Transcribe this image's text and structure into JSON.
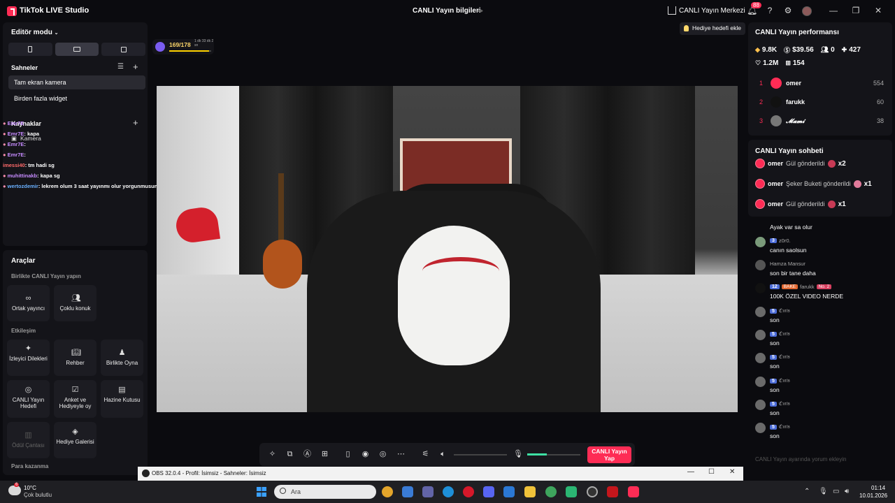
{
  "titlebar": {
    "app_title": "TikTok LIVE Studio",
    "center_title": "CANLI Yayın bilgileri",
    "live_center": "CANLI Yayın Merkezi",
    "notif_count": "88"
  },
  "left": {
    "editor_mode": "Editör modu",
    "scenes_title": "Sahneler",
    "scenes": [
      "Tam ekran kamera",
      "Birden fazla widget"
    ],
    "sources_title": "Kaynaklar",
    "source_camera": "Kamera",
    "tools_title": "Araçlar",
    "section_live_together": "Birlikte CANLI Yayın yapın",
    "section_engagement": "Etkileşim",
    "section_monetize": "Para kazanma",
    "tools_row1": [
      "Ortak yayıncı",
      "Çoklu konuk"
    ],
    "tools_row2": [
      "İzleyici Dilekleri",
      "Rehber",
      "Birlikte Oyna"
    ],
    "tools_row3": [
      "CANLI Yayın Hedefi",
      "Anket ve Hediyeyle oy",
      "Hazine Kutusu"
    ],
    "tools_row4": [
      "Ödül Çantası",
      "Hediye Galerisi"
    ]
  },
  "chat_overlay": [
    {
      "user": "Emr7E",
      "msg": ""
    },
    {
      "user": "Emr7E",
      "msg": ": kapa"
    },
    {
      "user": "Emr7E",
      "msg": ":"
    },
    {
      "user": "Emr7E",
      "msg": ":"
    },
    {
      "user": "imessi40",
      "msg": ": tm hadi sg"
    },
    {
      "user": "muhittinakb",
      "msg": ": kapa sg"
    },
    {
      "user": "wertozdemir",
      "msg": ": lekrem olum 3 saat yayınmı olur yorgunmusun"
    }
  ],
  "center": {
    "streak_value": "169/178",
    "streak_progress": 0.95,
    "streak_time": "1 dk 33 dk 2 sn",
    "gift_goal": "Hediye hedefi ekle",
    "go_live": "CANLI Yayın Yap"
  },
  "right": {
    "perf_title": "CANLI Yayın performansı",
    "stats_row1": [
      "9.8K",
      "$39.56",
      "0",
      "427"
    ],
    "stats_row2": [
      "1.2M",
      "154"
    ],
    "ranking": [
      {
        "rank": "1",
        "name": "omer",
        "score": "554"
      },
      {
        "rank": "2",
        "name": "farukk",
        "score": "60"
      },
      {
        "rank": "3",
        "name": "𝓜𝓪𝓶𝓲",
        "score": "38"
      }
    ],
    "chat_title": "CANLI Yayın sohbeti",
    "gifts": [
      {
        "name": "omer",
        "text": "Gül gönderildi",
        "count": "x2"
      },
      {
        "name": "omer",
        "text": "Şeker Buketi gönderildi",
        "count": "x1"
      },
      {
        "name": "omer",
        "text": "Gül gönderildi",
        "count": "x1"
      }
    ],
    "chat": [
      {
        "level": "",
        "user": "",
        "msg": "Ayak var sa olur"
      },
      {
        "level": "3",
        "user": "z0r0.",
        "msg": "canın saolsun"
      },
      {
        "level": "",
        "user": "Hamza Mansur",
        "msg": "son bir tane daha"
      },
      {
        "level": "12",
        "user": "farukk",
        "fan": "BAKE",
        "rank": "No. 2",
        "msg": "100K ÖZEL VIDEO NERDE"
      },
      {
        "level": "5",
        "user": "ℭ𝔪𝔦𝔰",
        "msg": "son"
      },
      {
        "level": "5",
        "user": "ℭ𝔪𝔦𝔰",
        "msg": "son"
      },
      {
        "level": "5",
        "user": "ℭ𝔪𝔦𝔰",
        "msg": "son"
      },
      {
        "level": "5",
        "user": "ℭ𝔪𝔦𝔰",
        "msg": "son"
      },
      {
        "level": "5",
        "user": "ℭ𝔪𝔦𝔰",
        "msg": "son"
      },
      {
        "level": "5",
        "user": "ℭ𝔪𝔦𝔰",
        "msg": "son"
      }
    ],
    "chat_placeholder": "CANLI Yayın ayarında yorum ekleyin"
  },
  "obs": {
    "title": "OBS 32.0.4 - Profil: İsimsiz - Sahneler: İsimsiz"
  },
  "taskbar": {
    "weather_temp": "10°C",
    "weather_desc": "Çok bulutlu",
    "weather_badge": "6",
    "search_placeholder": "Ara",
    "time": "01:14",
    "date": "10.01.2026"
  },
  "colors": {
    "accent": "#fe2c55",
    "volume": "#3ee0a4",
    "streak": "#ffd200"
  }
}
